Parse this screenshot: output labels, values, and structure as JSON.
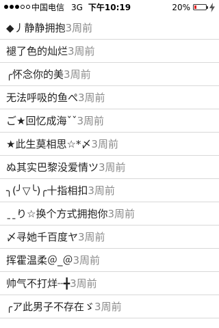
{
  "status_bar": {
    "carrier": "中国电信",
    "network": "3G",
    "time": "下午10:19",
    "battery_percent": "20%",
    "battery_level": 0.2,
    "battery_color": "#e02020"
  },
  "posts": [
    {
      "name": "◆丿静静拥抱",
      "when": "3周前"
    },
    {
      "name": "褪了色的灿烂",
      "when": "3周前"
    },
    {
      "name": "╭怀念你的美",
      "when": "3周前"
    },
    {
      "name": "无法呼吸的鱼ぺ",
      "when": "3周前"
    },
    {
      "name": "ご★回忆成海ˇˇ",
      "when": "3周前"
    },
    {
      "name": "★此生莫相思☆*〆",
      "when": "3周前"
    },
    {
      "name": "ぬ其实巴黎没爱情ツ",
      "when": "3周前"
    },
    {
      "name": "╮(╯▽╰)╭十指相扣",
      "when": "3周前"
    },
    {
      "name": "ˍˍり☆换个方式拥抱你",
      "when": "3周前"
    },
    {
      "name": "〆寻她千百度ヤ",
      "when": "3周前"
    },
    {
      "name": "挥霍温柔＠_＠",
      "when": "3周前"
    },
    {
      "name": "帅气不打烊┈╋",
      "when": "3周前"
    },
    {
      "name": "╭ア此男子不存在ゞ",
      "when": "3周前"
    }
  ]
}
